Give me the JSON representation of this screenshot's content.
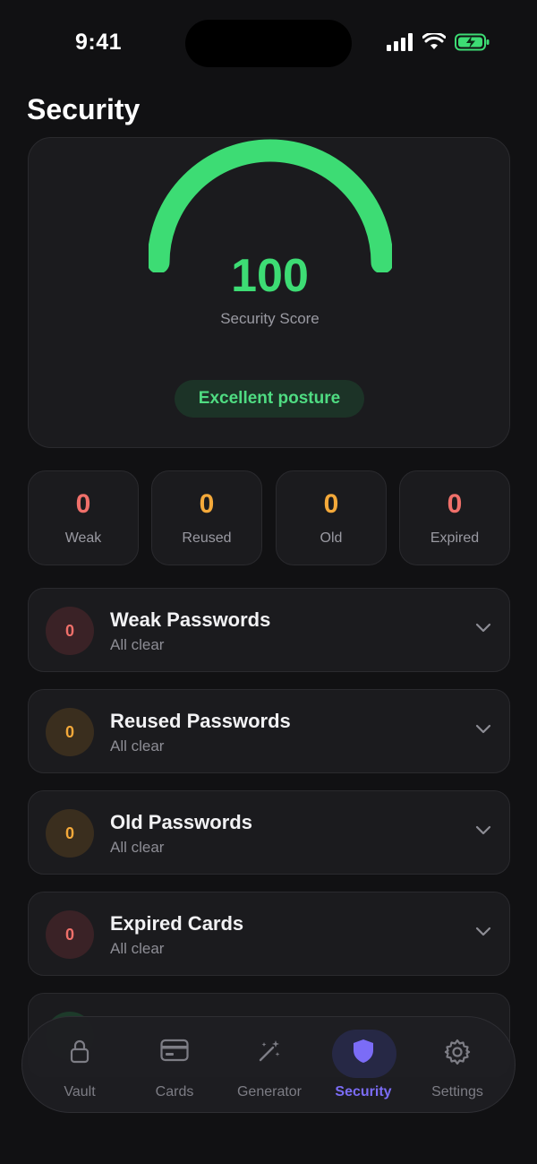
{
  "status": {
    "time": "9:41"
  },
  "page": {
    "title": "Security"
  },
  "score": {
    "value": "100",
    "label": "Security Score",
    "posture": "Excellent posture",
    "fraction": 1.0
  },
  "stats": [
    {
      "value": "0",
      "label": "Weak",
      "color": "#f0706a"
    },
    {
      "value": "0",
      "label": "Reused",
      "color": "#f4a93a"
    },
    {
      "value": "0",
      "label": "Old",
      "color": "#f4a93a"
    },
    {
      "value": "0",
      "label": "Expired",
      "color": "#f0706a"
    }
  ],
  "issues": [
    {
      "count": "0",
      "title": "Weak Passwords",
      "subtitle": "All clear",
      "tone": "red"
    },
    {
      "count": "0",
      "title": "Reused Passwords",
      "subtitle": "All clear",
      "tone": "orange"
    },
    {
      "count": "0",
      "title": "Old Passwords",
      "subtitle": "All clear",
      "tone": "orange"
    },
    {
      "count": "0",
      "title": "Expired Cards",
      "subtitle": "All clear",
      "tone": "red"
    }
  ],
  "tabs": [
    {
      "label": "Vault",
      "icon": "lock-icon"
    },
    {
      "label": "Cards",
      "icon": "card-icon"
    },
    {
      "label": "Generator",
      "icon": "magic-wand-icon"
    },
    {
      "label": "Security",
      "icon": "shield-icon",
      "active": true
    },
    {
      "label": "Settings",
      "icon": "gear-icon"
    }
  ],
  "colors": {
    "accent": "#7b6cf6",
    "success": "#3ddc74",
    "background": "#111113"
  }
}
